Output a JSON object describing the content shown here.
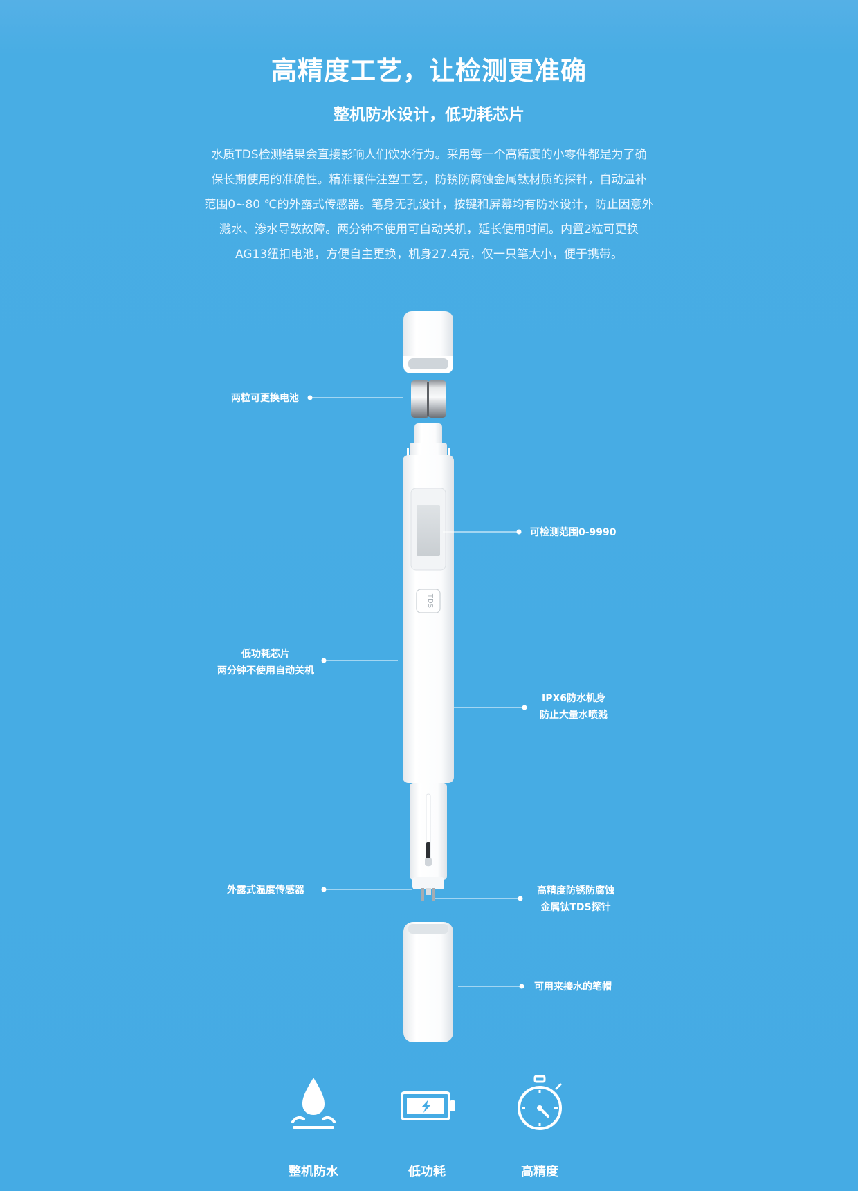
{
  "header": {
    "title": "高精度工艺，让检测更准确",
    "subtitle": "整机防水设计，低功耗芯片"
  },
  "description": {
    "lines": [
      "水质TDS检测结果会直接影响人们饮水行为。采用每一个高精度的小零件都是为了确",
      "保长期使用的准确性。精准镶件注塑工艺，防锈防腐蚀金属钛材质的探针，自动温补",
      "范围0~80 ℃的外露式传感器。笔身无孔设计，按键和屏幕均有防水设计，防止因意外",
      "溅水、渗水导致故障。两分钟不使用可自动关机，延长使用时间。内置2粒可更换",
      "AG13纽扣电池，方便自主更换，机身27.4克，仅一只笔大小，便于携带。"
    ]
  },
  "device": {
    "button_label": "TDS"
  },
  "callouts": {
    "battery": "两粒可更换电池",
    "range": "可检测范围0-9990",
    "chip_line1": "低功耗芯片",
    "chip_line2": "两分钟不使用自动关机",
    "waterproof_line1": "IPX6防水机身",
    "waterproof_line2": "防止大量水喷溅",
    "sensor": "外露式温度传感器",
    "probe_line1": "高精度防锈防腐蚀",
    "probe_line2": "金属钛TDS探针",
    "cap": "可用来接水的笔帽"
  },
  "features": [
    {
      "label": "整机防水",
      "icon": "water-drop-icon"
    },
    {
      "label": "低功耗",
      "icon": "battery-icon"
    },
    {
      "label": "高精度",
      "icon": "stopwatch-icon"
    }
  ],
  "colors": {
    "background": "#45abe4",
    "text": "#ffffff",
    "device_body": "#f7f8f9"
  }
}
